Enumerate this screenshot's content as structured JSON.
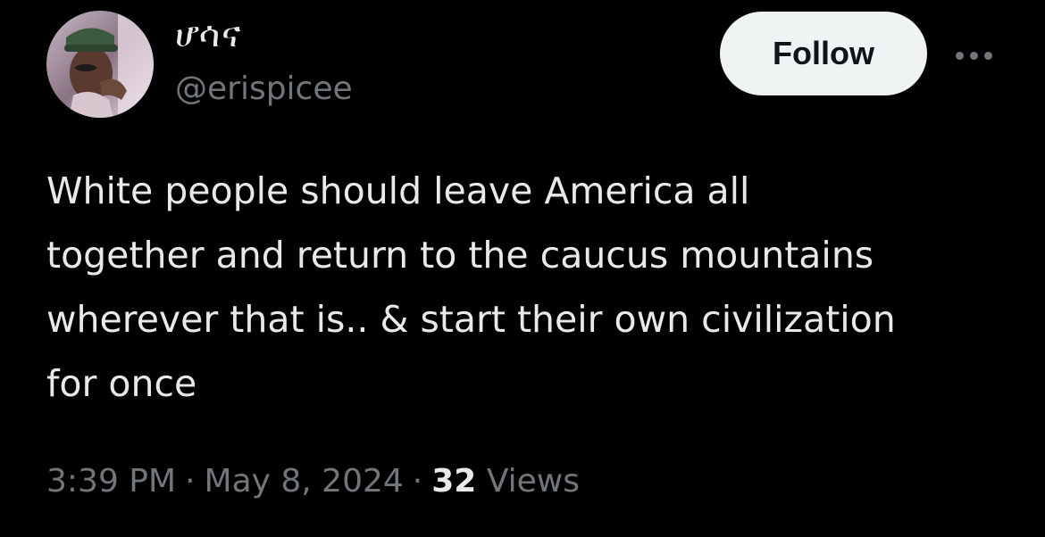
{
  "tweet": {
    "display_name": "ሆሳና",
    "handle": "@erispicee",
    "text": "White people should leave America all\ntogether and return to the caucus mountains\nwherever that is.. & start their own civilization\nfor once",
    "time": "3:39 PM",
    "separator": "·",
    "date": "May 8, 2024",
    "views_count": "32",
    "views_label": "Views"
  },
  "actions": {
    "follow_label": "Follow",
    "more_icon": "more-horizontal-icon"
  },
  "colors": {
    "background": "#000000",
    "primary_text": "#e7e9ea",
    "secondary_text": "#71767b",
    "follow_bg": "#eff3f4",
    "follow_text": "#0f1419"
  }
}
